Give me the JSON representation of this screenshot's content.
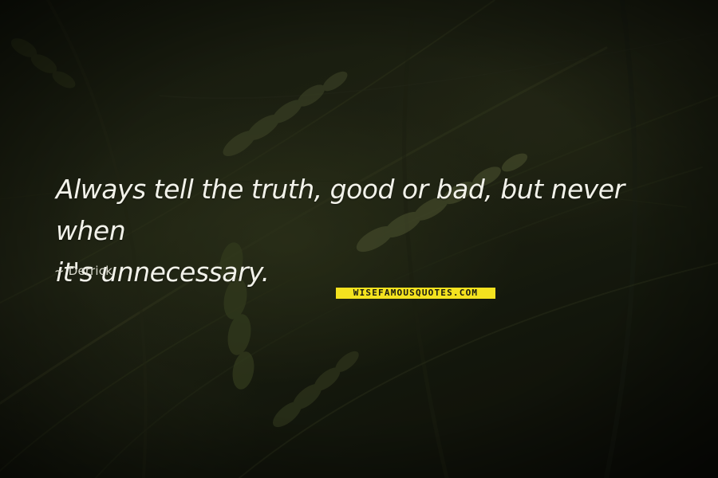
{
  "quote": {
    "line_1": "Always tell the truth, good or bad, but never when",
    "line_2": "it's unnecessary."
  },
  "author": "~ Derrick",
  "watermark": "WISEFAMOUSQUOTES.COM",
  "colors": {
    "quote_text": "#f2f2ea",
    "watermark_bg": "#f4e21f",
    "background": "#1d2212"
  }
}
